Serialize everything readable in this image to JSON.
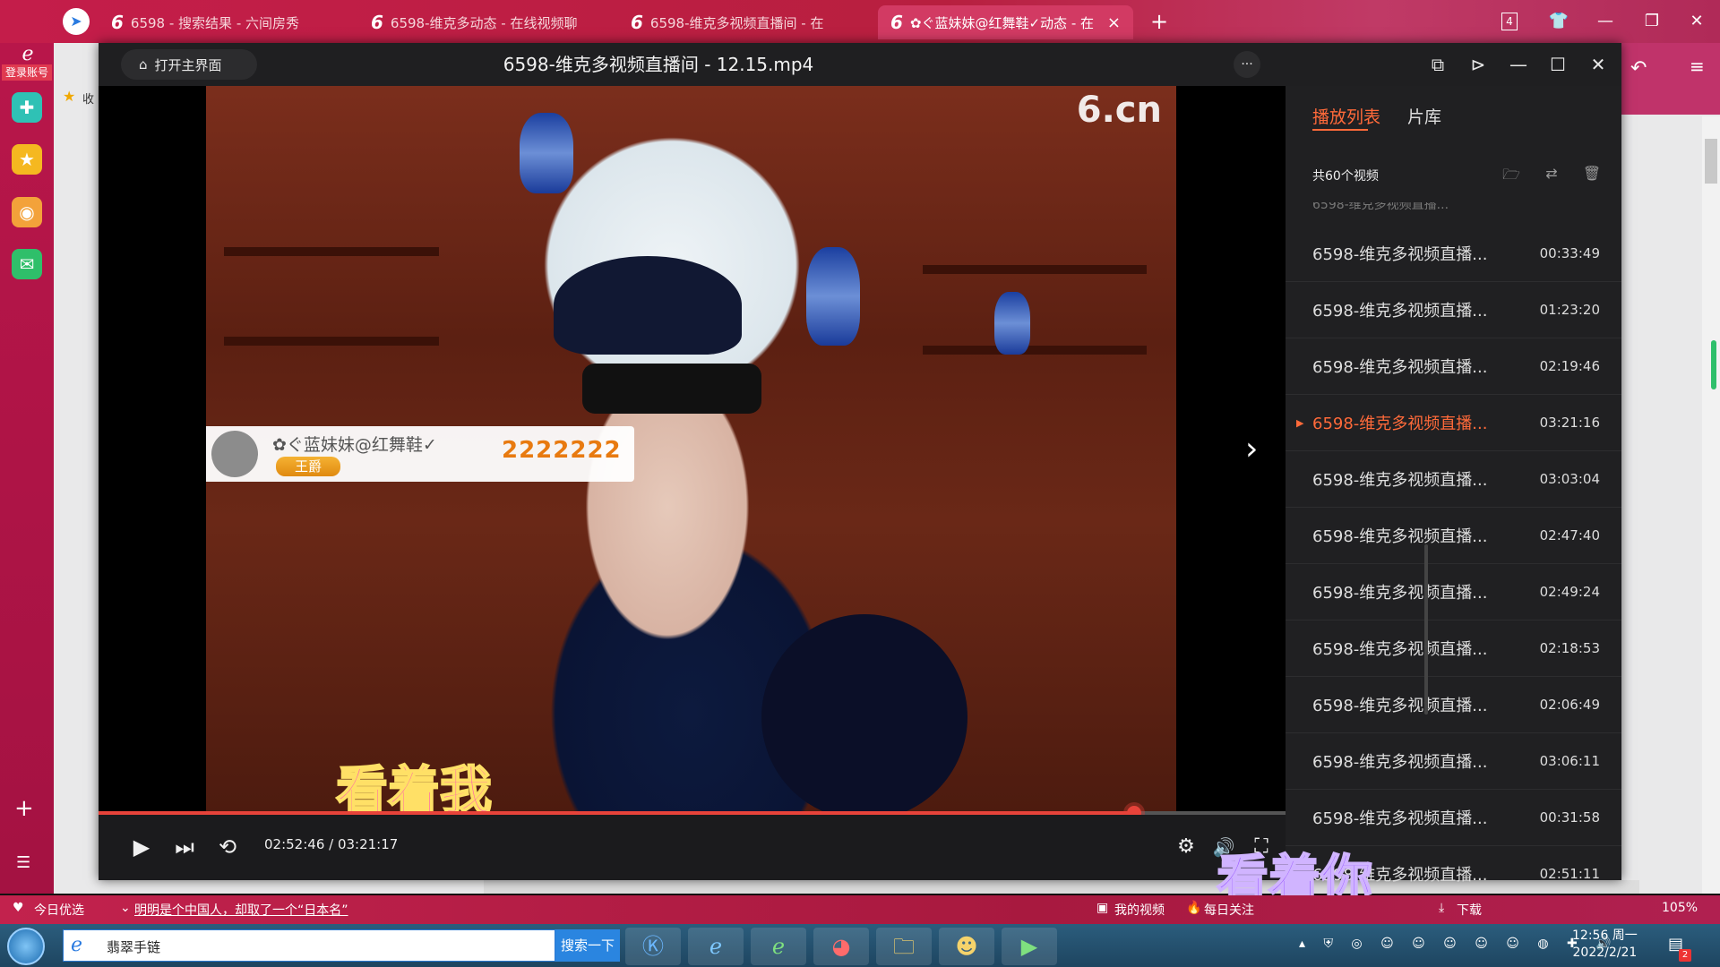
{
  "browser": {
    "tabs": [
      {
        "label": "6598 - 搜索结果 - 六间房秀",
        "icon": "six-icon"
      },
      {
        "label": "6598-维克多动态 - 在线视频聊",
        "icon": "six-icon"
      },
      {
        "label": "6598-维克多视频直播间 - 在",
        "icon": "six-icon"
      },
      {
        "label": "✿ぐ蓝妹妹@红舞鞋✓动态 - 在",
        "icon": "six-icon"
      }
    ],
    "new_tab": "+",
    "tab_count": "4",
    "login_label": "登录账号",
    "bookmark_label": "收"
  },
  "player": {
    "home_label": "打开主界面",
    "title": "6598-维克多视频直播间 - 12.15.mp4",
    "more": "···",
    "progress_fraction": 0.8725,
    "time": "02:52:46 / 03:21:17",
    "watermark": "6.cn",
    "gift": {
      "name": "✿ぐ蓝妹妹@红舞鞋✓",
      "badge": "王爵",
      "count": "2222222"
    },
    "caption": "看着我"
  },
  "playlist": {
    "tabs": [
      "播放列表",
      "片库"
    ],
    "count_label": "共60个视频",
    "items": [
      {
        "title": "6598-维克多视频直播...",
        "duration": "00:33:49",
        "current": false
      },
      {
        "title": "6598-维克多视频直播...",
        "duration": "01:23:20",
        "current": false
      },
      {
        "title": "6598-维克多视频直播...",
        "duration": "02:19:46",
        "current": false
      },
      {
        "title": "6598-维克多视频直播...",
        "duration": "03:21:16",
        "current": true
      },
      {
        "title": "6598-维克多视频直播...",
        "duration": "03:03:04",
        "current": false
      },
      {
        "title": "6598-维克多视频直播...",
        "duration": "02:47:40",
        "current": false
      },
      {
        "title": "6598-维克多视频直播...",
        "duration": "02:49:24",
        "current": false
      },
      {
        "title": "6598-维克多视频直播...",
        "duration": "02:18:53",
        "current": false
      },
      {
        "title": "6598-维克多视频直播...",
        "duration": "02:06:49",
        "current": false
      },
      {
        "title": "6598-维克多视频直播...",
        "duration": "03:06:11",
        "current": false
      },
      {
        "title": "6598-维克多视频直播...",
        "duration": "00:31:58",
        "current": false
      },
      {
        "title": "6598-维克多视频直播...",
        "duration": "02:51:11",
        "current": false
      }
    ]
  },
  "overlay_caption": "看着你",
  "statusbar": {
    "today": "今日优选",
    "news": "明明是个中国人，却取了一个“日本名”",
    "my_video": "我的视频",
    "daily": "每日关注",
    "download": "下载",
    "zoom": "105%"
  },
  "taskbar": {
    "search_text": "翡翠手链",
    "search_button": "搜索一下",
    "time": "12:56 周一",
    "date": "2022/2/21",
    "notif_count": "2"
  },
  "colors": {
    "accent": "#ff6a3a",
    "progress": "#e8433a",
    "browser": "#c41d4a"
  }
}
